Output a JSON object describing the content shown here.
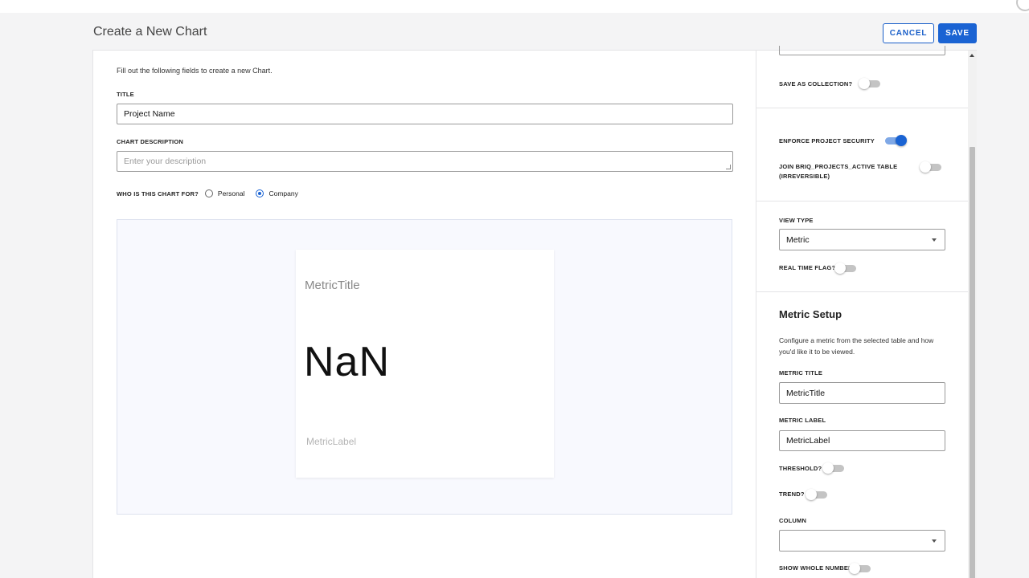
{
  "page": {
    "title": "Create a New Chart"
  },
  "actions": {
    "cancel": "CANCEL",
    "save": "SAVE"
  },
  "form": {
    "intro": "Fill out the following fields to create a new Chart.",
    "title_label": "TITLE",
    "title_value": "Project Name",
    "description_label": "CHART DESCRIPTION",
    "description_placeholder": "Enter your description",
    "audience": {
      "question": "WHO IS THIS CHART FOR?",
      "options": [
        "Personal",
        "Company"
      ],
      "selected": "Company"
    }
  },
  "preview": {
    "metric_title": "MetricTitle",
    "metric_value": "NaN",
    "metric_label": "MetricLabel"
  },
  "settings": {
    "save_as_collection": {
      "label": "SAVE AS COLLECTION?",
      "on": false
    },
    "enforce_project_security": {
      "label": "ENFORCE PROJECT SECURITY",
      "on": true
    },
    "join_table": {
      "label_line1": "JOIN Briq_Projects_Active TABLE",
      "label_line2": "(IRREVERSIBLE)",
      "on": false
    },
    "view_type": {
      "label": "VIEW TYPE",
      "value": "Metric"
    },
    "real_time_flag": {
      "label": "REAL TIME FLAG?",
      "on": false
    }
  },
  "metric_setup": {
    "heading": "Metric Setup",
    "description": "Configure a metric from the selected table and how you'd like it to be viewed.",
    "metric_title_label": "METRIC TITLE",
    "metric_title_value": "MetricTitle",
    "metric_label_label": "METRIC LABEL",
    "metric_label_value": "MetricLabel",
    "threshold": {
      "label": "THRESHOLD?",
      "on": false
    },
    "trend": {
      "label": "TREND?",
      "on": false
    },
    "column_label": "COLUMN",
    "column_value": "",
    "show_whole_number": {
      "label": "SHOW WHOLE NUMBER",
      "on": false
    }
  },
  "colors": {
    "primary": "#1a63d3",
    "background": "#f4f4f5",
    "preview_bg": "#f8f9fe"
  }
}
